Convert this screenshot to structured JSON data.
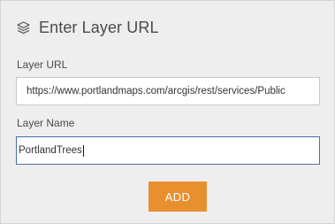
{
  "header": {
    "icon": "layers-icon",
    "title": "Enter Layer URL"
  },
  "layer_url": {
    "label": "Layer URL",
    "value": "https://www.portlandmaps.com/arcgis/rest/services/Public"
  },
  "layer_name": {
    "label": "Layer Name",
    "value": "PortlandTrees"
  },
  "actions": {
    "add_label": "ADD"
  },
  "colors": {
    "panel_background": "#eeeeee",
    "accent": "#e8902f",
    "focus_border": "#4a70a4"
  }
}
